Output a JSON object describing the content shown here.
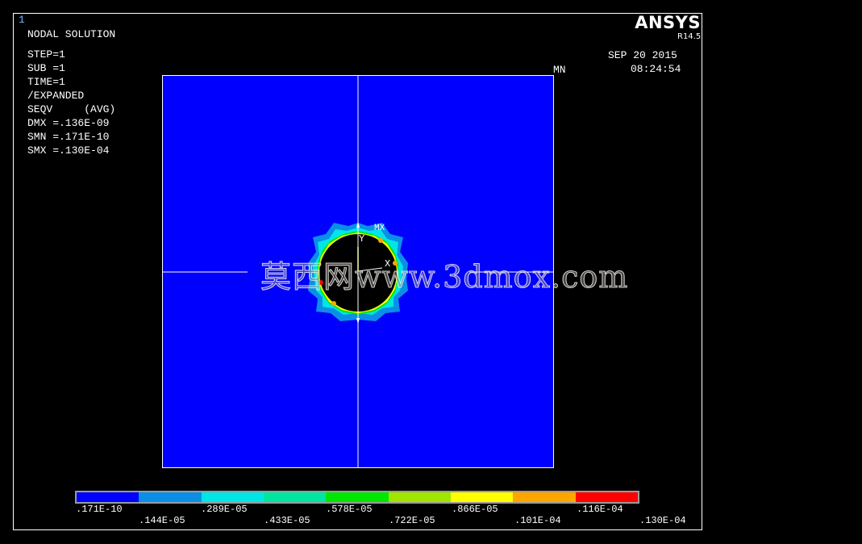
{
  "window_number": "1",
  "brand": "ANSYS",
  "version": "R14.5",
  "date": "SEP 20 2015",
  "time": "08:24:54",
  "info_lines": [
    "NODAL SOLUTION",
    "STEP=1",
    "SUB =1",
    "TIME=1",
    "/EXPANDED",
    "SEQV     (AVG)",
    "DMX =.136E-09",
    "SMN =.171E-10",
    "SMX =.130E-04"
  ],
  "min_marker": "MN",
  "max_marker": "MX",
  "axis_labels": {
    "x": "X",
    "y": "Y"
  },
  "watermark": "莫西网www.3dmox.com",
  "legend": {
    "colors": [
      "#0000ff",
      "#0b8fe6",
      "#00e6e6",
      "#00e6a0",
      "#00e600",
      "#a0e600",
      "#ffff00",
      "#ffa500",
      "#ff0000"
    ],
    "labels_top": [
      ".171E-10",
      ".289E-05",
      ".578E-05",
      ".866E-05",
      ".116E-04"
    ],
    "labels_bottom": [
      ".144E-05",
      ".433E-05",
      ".722E-05",
      ".101E-04",
      ".130E-04"
    ]
  }
}
